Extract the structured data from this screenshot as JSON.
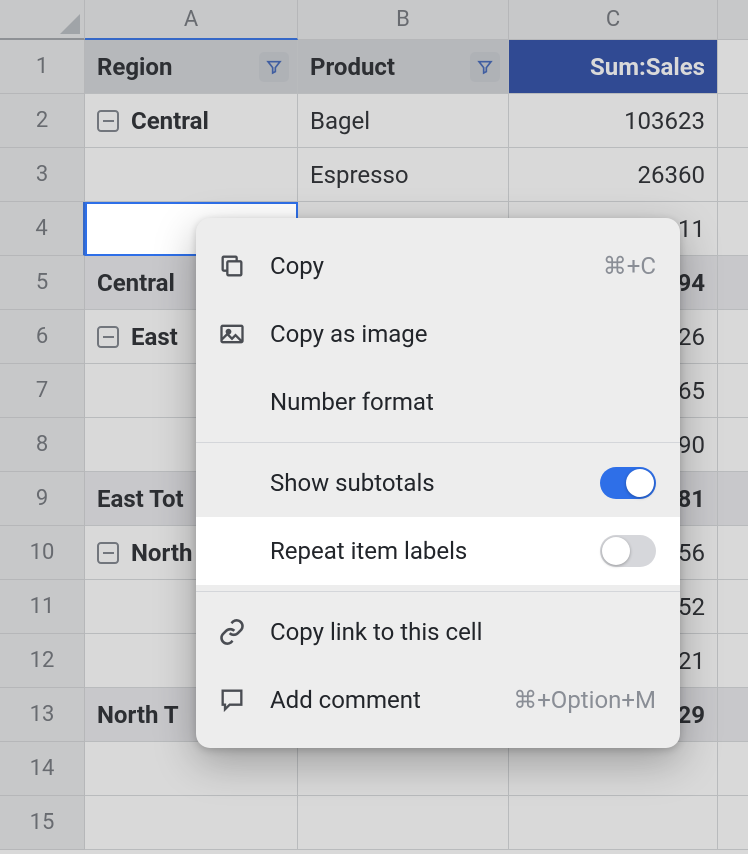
{
  "columns": {
    "A": "A",
    "B": "B",
    "C": "C"
  },
  "headers": {
    "region": "Region",
    "product": "Product",
    "sum": "Sum:Sales"
  },
  "rows": [
    {
      "n": "1"
    },
    {
      "n": "2",
      "A": "Central",
      "B": "Bagel",
      "C": "103623",
      "group": true
    },
    {
      "n": "3",
      "B": "Espresso",
      "C": "26360"
    },
    {
      "n": "4",
      "C_suffix": "11"
    },
    {
      "n": "5",
      "A": "Central",
      "C_suffix": "94",
      "total": true
    },
    {
      "n": "6",
      "A": "East",
      "C_suffix": "26",
      "group": true
    },
    {
      "n": "7",
      "C_suffix": "65"
    },
    {
      "n": "8",
      "C_suffix": "90"
    },
    {
      "n": "9",
      "A": "East Tot",
      "C_suffix": "81",
      "total": true
    },
    {
      "n": "10",
      "A": "North",
      "C_suffix": "56",
      "group": true
    },
    {
      "n": "11",
      "C_suffix": "52"
    },
    {
      "n": "12",
      "C_suffix": "21"
    },
    {
      "n": "13",
      "A": "North T",
      "C_suffix": "29",
      "total": true
    },
    {
      "n": "14"
    },
    {
      "n": "15"
    }
  ],
  "menu": {
    "copy": {
      "label": "Copy",
      "shortcut": "⌘+C"
    },
    "copy_image": {
      "label": "Copy as image"
    },
    "number_format": {
      "label": "Number format"
    },
    "show_subtotals": {
      "label": "Show subtotals",
      "on": true
    },
    "repeat_labels": {
      "label": "Repeat item labels",
      "on": false
    },
    "copy_link": {
      "label": "Copy link to this cell"
    },
    "add_comment": {
      "label": "Add comment",
      "shortcut": "⌘+Option+M"
    }
  }
}
